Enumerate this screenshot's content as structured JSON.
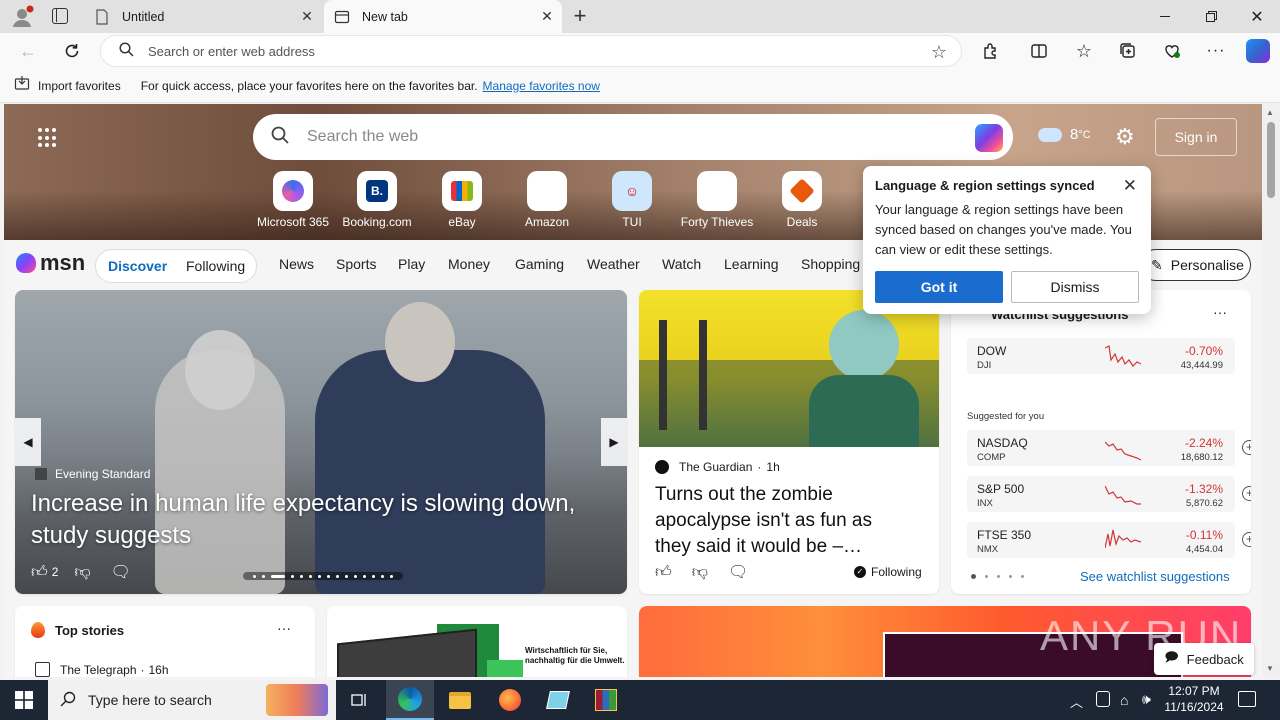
{
  "tabs": [
    {
      "title": "Untitled",
      "active": false
    },
    {
      "title": "New tab",
      "active": true
    }
  ],
  "toolbar": {
    "address_placeholder": "Search or enter web address"
  },
  "favbar": {
    "import_label": "Import favorites",
    "hint": "For quick access, place your favorites here on the favorites bar.",
    "manage_link": "Manage favorites now"
  },
  "hero": {
    "search_placeholder": "Search the web",
    "weather_temp": "8",
    "weather_unit": "°C",
    "sign_in": "Sign in",
    "quick_links": [
      {
        "label": "Microsoft 365",
        "icon": "microsoft365-icon"
      },
      {
        "label": "Booking.com",
        "icon": "booking-icon"
      },
      {
        "label": "eBay",
        "icon": "ebay-icon"
      },
      {
        "label": "Amazon",
        "icon": "amazon-icon"
      },
      {
        "label": "TUI",
        "icon": "tui-icon"
      },
      {
        "label": "Forty Thieves",
        "icon": "forty-thieves-icon"
      },
      {
        "label": "Deals",
        "icon": "deals-icon"
      }
    ]
  },
  "nav": {
    "brand": "msn",
    "discover": "Discover",
    "following": "Following",
    "items": [
      "News",
      "Sports",
      "Play",
      "Money",
      "Gaming",
      "Weather",
      "Watch",
      "Learning",
      "Shopping"
    ],
    "personalise": "Personalise"
  },
  "popup": {
    "title": "Language & region settings synced",
    "body": "Your language & region settings have been synced based on changes you've made. You can view or edit these settings.",
    "got_it": "Got it",
    "dismiss": "Dismiss"
  },
  "hero_story": {
    "source": "Evening Standard",
    "headline": "Increase in human life expectancy is slowing down, study suggests",
    "likes": "2"
  },
  "zombie_story": {
    "source": "The Guardian",
    "age": "1h",
    "headline": "Turns out the zombie apocalypse isn't as fun as they said it would be –…",
    "following": "Following"
  },
  "watchlist": {
    "title": "Watchlist suggestions",
    "suggested_label": "Suggested for you",
    "see_more": "See watchlist suggestions",
    "primary": {
      "name": "DOW",
      "symbol": "DJI",
      "change": "-0.70%",
      "value": "43,444.99"
    },
    "stocks": [
      {
        "name": "NASDAQ",
        "symbol": "COMP",
        "change": "-2.24%",
        "value": "18,680.12"
      },
      {
        "name": "S&P 500",
        "symbol": "INX",
        "change": "-1.32%",
        "value": "5,870.62"
      },
      {
        "name": "FTSE 350",
        "symbol": "NMX",
        "change": "-0.11%",
        "value": "4,454.04"
      }
    ]
  },
  "top_stories": {
    "title": "Top stories",
    "first_source": "The Telegraph",
    "first_age": "16h"
  },
  "ad": {
    "text": "Wirtschaftlich für Sie, nachhaltig für die Umwelt."
  },
  "feedback": "Feedback",
  "watermark": "ANY RUN",
  "taskbar": {
    "search_placeholder": "Type here to search",
    "time": "12:07 PM",
    "date": "11/16/2024"
  },
  "colors": {
    "accent": "#0f6cbd",
    "primary_button": "#1a6dcf",
    "negative": "#d13438",
    "taskbar": "#1c2634"
  }
}
